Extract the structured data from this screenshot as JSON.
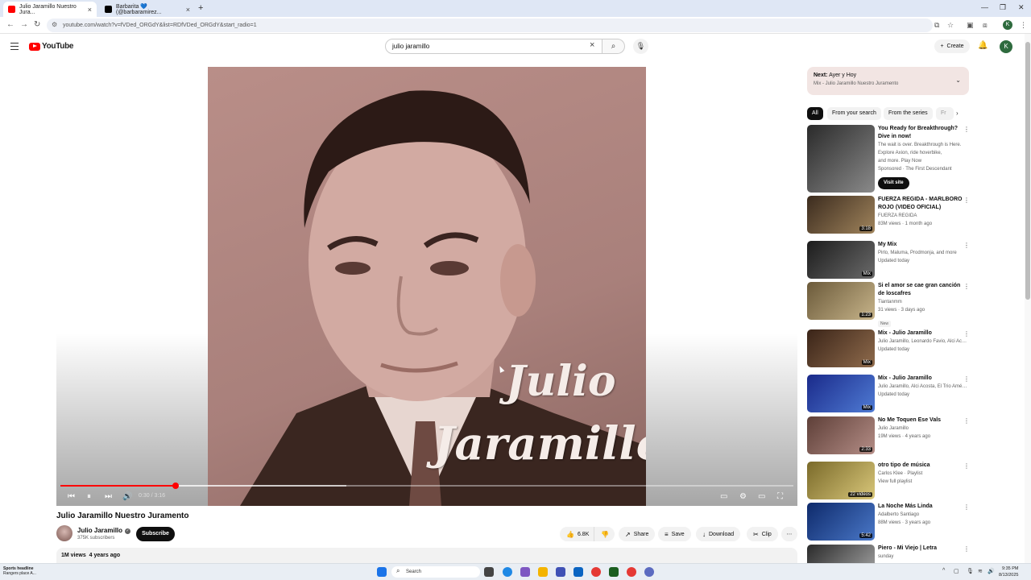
{
  "browser": {
    "tabs": [
      {
        "title": "Julio Jaramillo Nuestro Jura...",
        "active": true,
        "color": "#ff0000"
      },
      {
        "title": "Barbarita 💙 (@barbaramirez...",
        "active": false,
        "color": "#000000"
      }
    ],
    "url": "youtube.com/watch?v=fVDed_ORGdY&list=RDfVDed_ORGdY&start_radio=1",
    "profile_initial": "K"
  },
  "header": {
    "logo_text": "YouTube",
    "search_value": "julio jaramillo",
    "create_label": "Create",
    "avatar_initial": "K"
  },
  "player": {
    "art_line1": "Julio",
    "art_line2": "Jaramillo",
    "time_text": "0:30 / 3:16",
    "progress_fraction": 0.157,
    "buffered_fraction": 0.39
  },
  "video": {
    "title": "Julio Jaramillo Nuestro Juramento",
    "channel": "Julio Jaramillo",
    "subscribers": "375K subscribers",
    "subscribe_label": "Subscribe",
    "likes": "6.8K",
    "share_label": "Share",
    "save_label": "Save",
    "download_label": "Download",
    "clip_label": "Clip",
    "views": "1M views",
    "age": "4 years ago"
  },
  "sidebar": {
    "next_label": "Next:",
    "next_title": "Ayer y Hoy",
    "next_sub": "Mix - Julio Jaramillo Nuestro Juramento",
    "chips": [
      "All",
      "From your search",
      "From the series",
      "Fr"
    ],
    "recs": [
      {
        "title": "You Ready for Breakthrough? Dive in now!",
        "meta1": "The wait is over. Breakthrough is Here. Explore Axion, ride hoverbike,",
        "meta2": "and more. Play Now",
        "meta3": "Sponsored · The First Descendant",
        "cta": "Visit site",
        "colors": [
          "#2a2a2a",
          "#8a8a8a"
        ]
      },
      {
        "title": "FUERZA REGIDA - MARLBORO ROJO (VIDEO OFICIAL)",
        "meta1": "FUERZA REGIDA",
        "meta2": "83M views · 1 month ago",
        "duration": "3:18",
        "colors": [
          "#3b2b1e",
          "#a0845c"
        ]
      },
      {
        "title": "My Mix",
        "meta1": "Pirlo, Maluma, Prodmonja, and more",
        "meta2": "Updated today",
        "duration": "Mix",
        "colors": [
          "#1c1c1c",
          "#6a6a6a"
        ]
      },
      {
        "title": "Si el amor se cae  gran canción de loscafres",
        "meta1": "Tiantanmm",
        "meta2": "31 views · 3 days ago",
        "badge": "New",
        "duration": "1:23",
        "colors": [
          "#6b5a3a",
          "#c7b48a"
        ]
      },
      {
        "title": "Mix - Julio Jaramillo",
        "meta1": "Julio Jaramillo, Leonardo Favio, Alci Aco...",
        "meta2": "Updated today",
        "duration": "Mix",
        "colors": [
          "#3a2418",
          "#8f6b4c"
        ]
      },
      {
        "title": "Mix - Julio Jaramillo",
        "meta1": "Julio Jaramillo, Alci Acosta, El Trio Améri...",
        "meta2": "Updated today",
        "duration": "Mix",
        "colors": [
          "#1a2a8a",
          "#4f7bd4"
        ]
      },
      {
        "title": "No Me Toquen Ese Vals",
        "meta1": "Julio Jaramillo",
        "meta2": "19M views · 4 years ago",
        "duration": "2:33",
        "colors": [
          "#5e3f38",
          "#b48d86"
        ]
      },
      {
        "title": "otro tipo de música",
        "meta1": "Carlos Klee · Playlist",
        "meta2": "View full playlist",
        "duration": "22 videos",
        "colors": [
          "#7a6a2a",
          "#d9c77a"
        ]
      },
      {
        "title": "La Noche Más Linda",
        "meta1": "Adalberto Santiago",
        "meta2": "88M views · 3 years ago",
        "duration": "5:42",
        "colors": [
          "#0e2a6b",
          "#4a78c8"
        ]
      },
      {
        "title": "Piero - Mi Viejo | Letra",
        "meta1": "sunday",
        "meta2": "",
        "duration": "",
        "colors": [
          "#2a2a2a",
          "#aaaaaa"
        ]
      }
    ]
  },
  "taskbar": {
    "news_line1": "Sports headline",
    "news_line2": "Rangers place A...",
    "search_label": "Search",
    "time": "9:35 PM",
    "date": "8/13/2025"
  }
}
